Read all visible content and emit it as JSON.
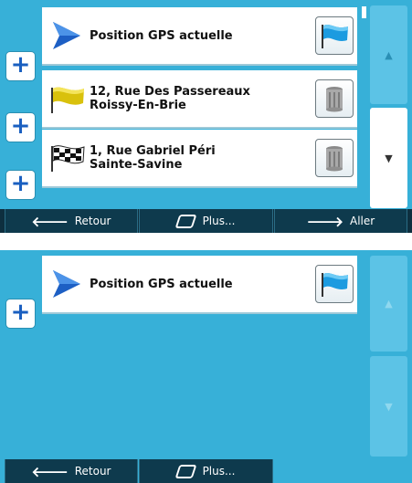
{
  "screen1": {
    "cards": [
      {
        "line1": "Position GPS actuelle",
        "line2": "",
        "left_icon": "gps-arrow-icon",
        "right_icon": "blue-flag-icon"
      },
      {
        "line1": "12, Rue Des Passereaux",
        "line2": "Roissy-En-Brie",
        "left_icon": "yellow-flag-icon",
        "right_icon": "trash-can-icon"
      },
      {
        "line1": "1, Rue Gabriel Péri",
        "line2": "Sainte-Savine",
        "left_icon": "checkered-flag-icon",
        "right_icon": "trash-can-icon"
      }
    ],
    "plus_label": "+",
    "scroll_up": "▲",
    "scroll_down": "▼",
    "bottom": {
      "back": "Retour",
      "more": "Plus...",
      "go": "Aller"
    }
  },
  "screen2": {
    "cards": [
      {
        "line1": "Position GPS actuelle",
        "line2": "",
        "left_icon": "gps-arrow-icon",
        "right_icon": "blue-flag-icon"
      }
    ],
    "plus_label": "+",
    "scroll_up": "▲",
    "scroll_down": "▼",
    "bottom": {
      "back": "Retour",
      "more": "Plus..."
    }
  },
  "colors": {
    "background": "#37b0d8",
    "bar": "#0e2f3f",
    "plus": "#1a5fc0"
  }
}
